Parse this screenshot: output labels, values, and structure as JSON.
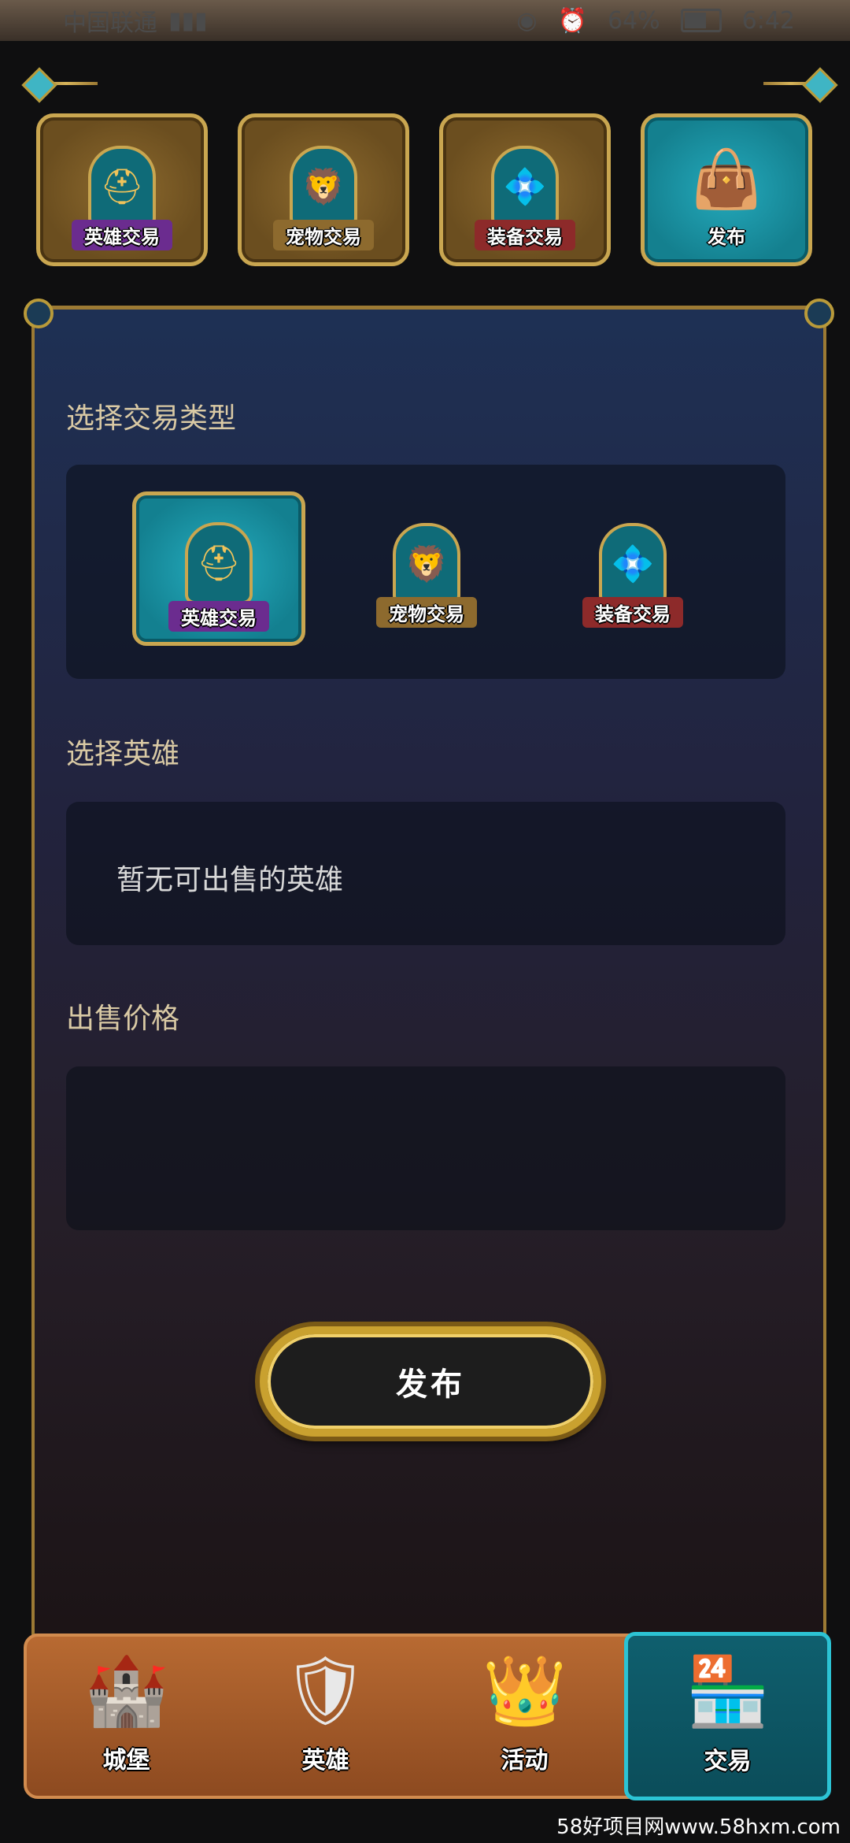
{
  "status_bar": {
    "carrier": "中国联通",
    "battery": "64%",
    "time": "6:42"
  },
  "top_tabs": [
    {
      "label": "英雄交易",
      "icon": "helmet-icon"
    },
    {
      "label": "宠物交易",
      "icon": "lion-icon"
    },
    {
      "label": "装备交易",
      "icon": "gem-icon"
    },
    {
      "label": "发布",
      "icon": "bag-icon",
      "active": true
    }
  ],
  "form": {
    "trade_type_title": "选择交易类型",
    "trade_types": [
      {
        "label": "英雄交易",
        "selected": true
      },
      {
        "label": "宠物交易",
        "selected": false
      },
      {
        "label": "装备交易",
        "selected": false
      }
    ],
    "hero_title": "选择英雄",
    "hero_placeholder": "暂无可出售的英雄",
    "price_title": "出售价格",
    "price_value": "",
    "publish_label": "发布"
  },
  "bottom_nav": [
    {
      "label": "城堡",
      "icon": "castle-icon"
    },
    {
      "label": "英雄",
      "icon": "hero-card-icon"
    },
    {
      "label": "活动",
      "icon": "crown-icon"
    },
    {
      "label": "交易",
      "icon": "market-stall-icon",
      "active": true
    }
  ],
  "watermark": "58好项目网www.58hxm.com"
}
